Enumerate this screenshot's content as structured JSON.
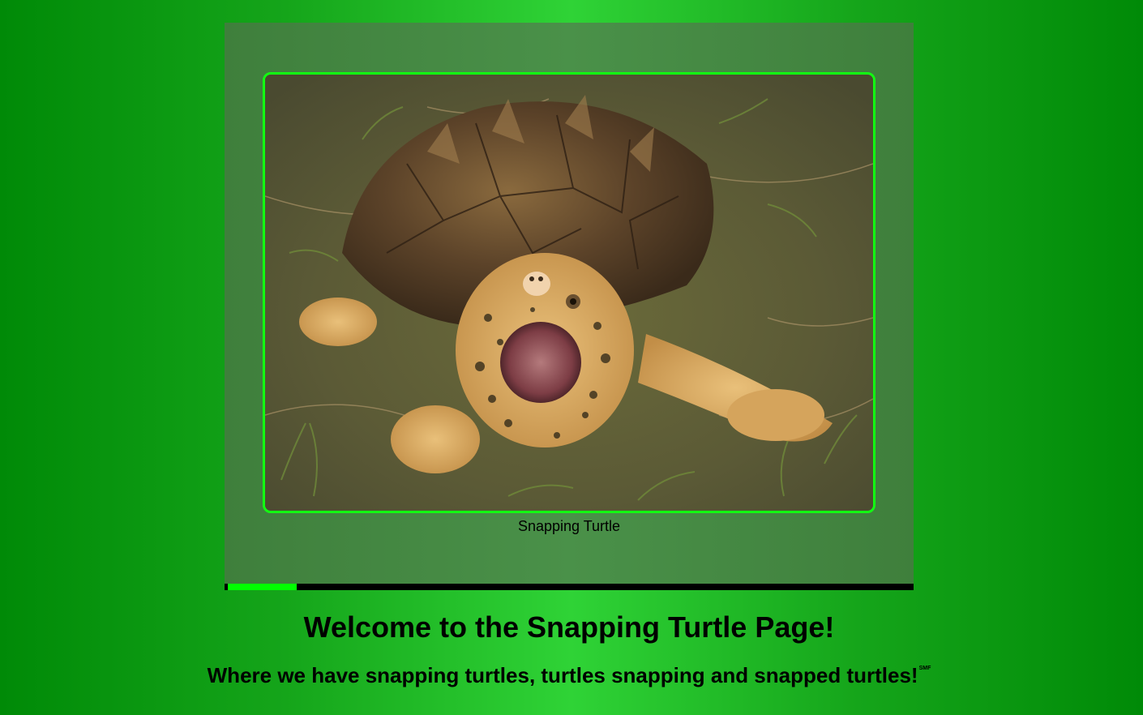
{
  "gallery": {
    "image_alt": "Snapping Turtle",
    "caption": "Snapping Turtle",
    "progress": 0.1
  },
  "hero": {
    "title": "Welcome to the Snapping Turtle Page!",
    "tagline": "Where we have snapping turtles, turtles snapping and snapped turtles!",
    "service_mark": "SMF"
  },
  "colors": {
    "accent": "#00ff00",
    "panel": "#458a43",
    "background_edge": "#008a07",
    "background_center": "#2fd336"
  }
}
